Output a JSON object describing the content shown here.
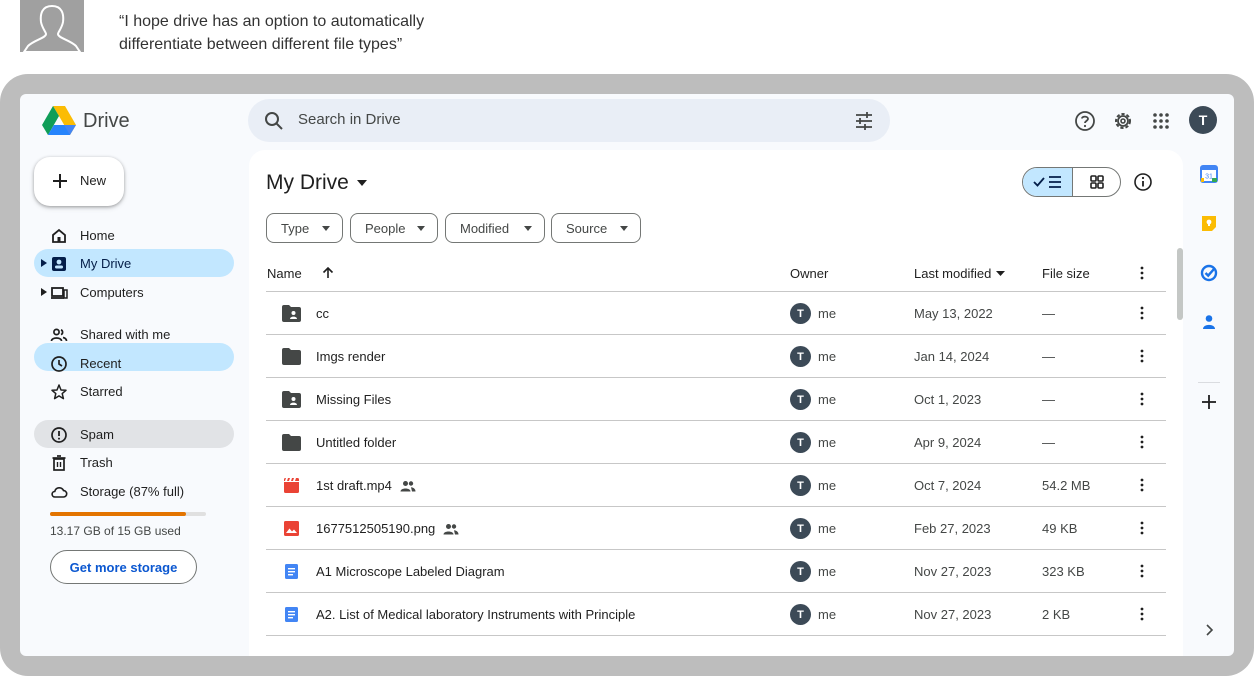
{
  "quote": {
    "line1": "“I hope drive has an option to automatically",
    "line2": "differentiate between different file types”"
  },
  "app": {
    "name": "Drive",
    "avatar_letter": "T"
  },
  "search": {
    "placeholder": "Search in Drive"
  },
  "new_button": {
    "label": "New"
  },
  "nav": {
    "home": "Home",
    "my_drive": "My Drive",
    "computers": "Computers",
    "shared": "Shared with me",
    "recent": "Recent",
    "starred": "Starred",
    "spam": "Spam",
    "trash": "Trash",
    "storage": "Storage (87% full)"
  },
  "storage": {
    "used_text": "13.17 GB of 15 GB used",
    "percent_full": 87,
    "cta": "Get more storage",
    "bar_color": "#e37400"
  },
  "main": {
    "title": "My Drive"
  },
  "filters": {
    "type": "Type",
    "people": "People",
    "modified": "Modified",
    "source": "Source"
  },
  "table": {
    "headers": {
      "name": "Name",
      "owner": "Owner",
      "last_modified": "Last modified",
      "size": "File size"
    },
    "rows": [
      {
        "name": "cc",
        "kind": "shared-folder-icon",
        "owner": "me",
        "modified": "May 13, 2022",
        "size": "—"
      },
      {
        "name": "Imgs render",
        "kind": "folder-icon",
        "owner": "me",
        "modified": "Jan 14, 2024",
        "size": "—"
      },
      {
        "name": "Missing Files",
        "kind": "shared-folder-icon",
        "owner": "me",
        "modified": "Oct 1, 2023",
        "size": "—"
      },
      {
        "name": "Untitled folder",
        "kind": "folder-icon",
        "owner": "me",
        "modified": "Apr 9, 2024",
        "size": "—"
      },
      {
        "name": "1st draft.mp4",
        "kind": "video-icon",
        "owner": "me",
        "modified": "Oct 7, 2024",
        "size": "54.2 MB",
        "shared": true
      },
      {
        "name": "1677512505190.png",
        "kind": "image-icon",
        "owner": "me",
        "modified": "Feb 27, 2023",
        "size": "49 KB",
        "shared": true
      },
      {
        "name": "A1 Microscope Labeled Diagram",
        "kind": "doc-icon",
        "owner": "me",
        "modified": "Nov 27, 2023",
        "size": "323 KB"
      },
      {
        "name": "A2. List of Medical laboratory Instruments with Principle",
        "kind": "doc-icon",
        "owner": "me",
        "modified": "Nov 27, 2023",
        "size": "2 KB"
      }
    ]
  },
  "rail": {
    "calendar_number": "31"
  },
  "colors": {
    "accent": "#0b57d0",
    "active_nav": "#c2e7ff",
    "video": "#ea4335",
    "doc": "#4285f4"
  }
}
